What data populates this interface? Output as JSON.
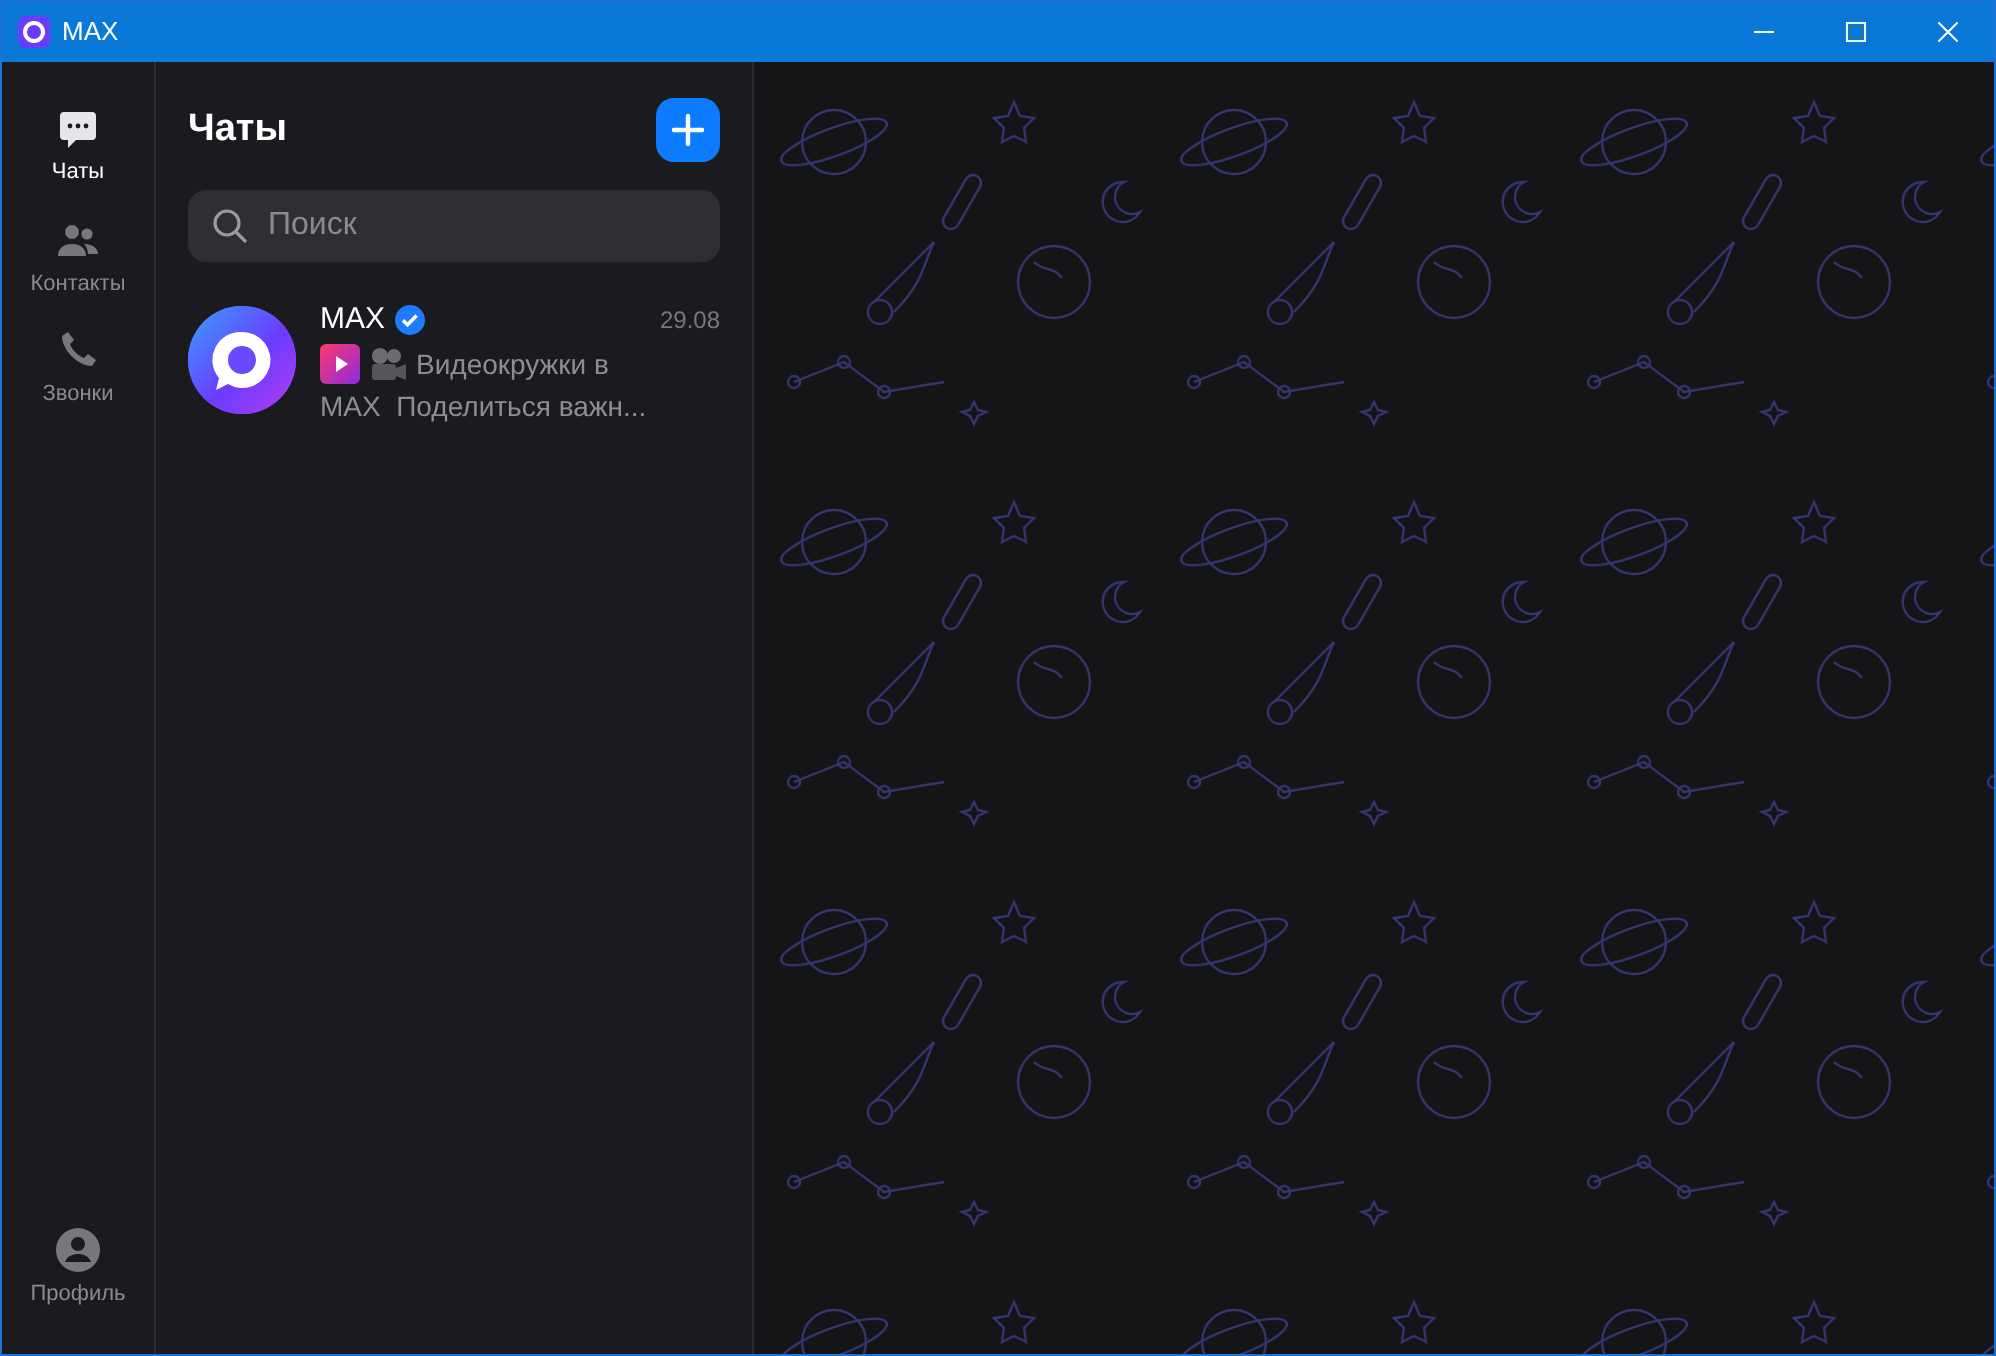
{
  "window": {
    "title": "MAX"
  },
  "nav": [
    {
      "label": "Чаты",
      "kind": "chats",
      "selected": true
    },
    {
      "label": "Контакты",
      "kind": "contacts",
      "selected": false
    },
    {
      "label": "Звонки",
      "kind": "calls",
      "selected": false
    }
  ],
  "profile": {
    "label": "Профиль"
  },
  "chat_list": {
    "title": "Чаты",
    "search": {
      "placeholder": "Поиск"
    },
    "chats": [
      {
        "name": "MAX",
        "verified": true,
        "date": "29.08",
        "preview_lines": [
          "Видеокружки в",
          "MAX  Поделиться важн..."
        ],
        "selected": false
      }
    ]
  }
}
